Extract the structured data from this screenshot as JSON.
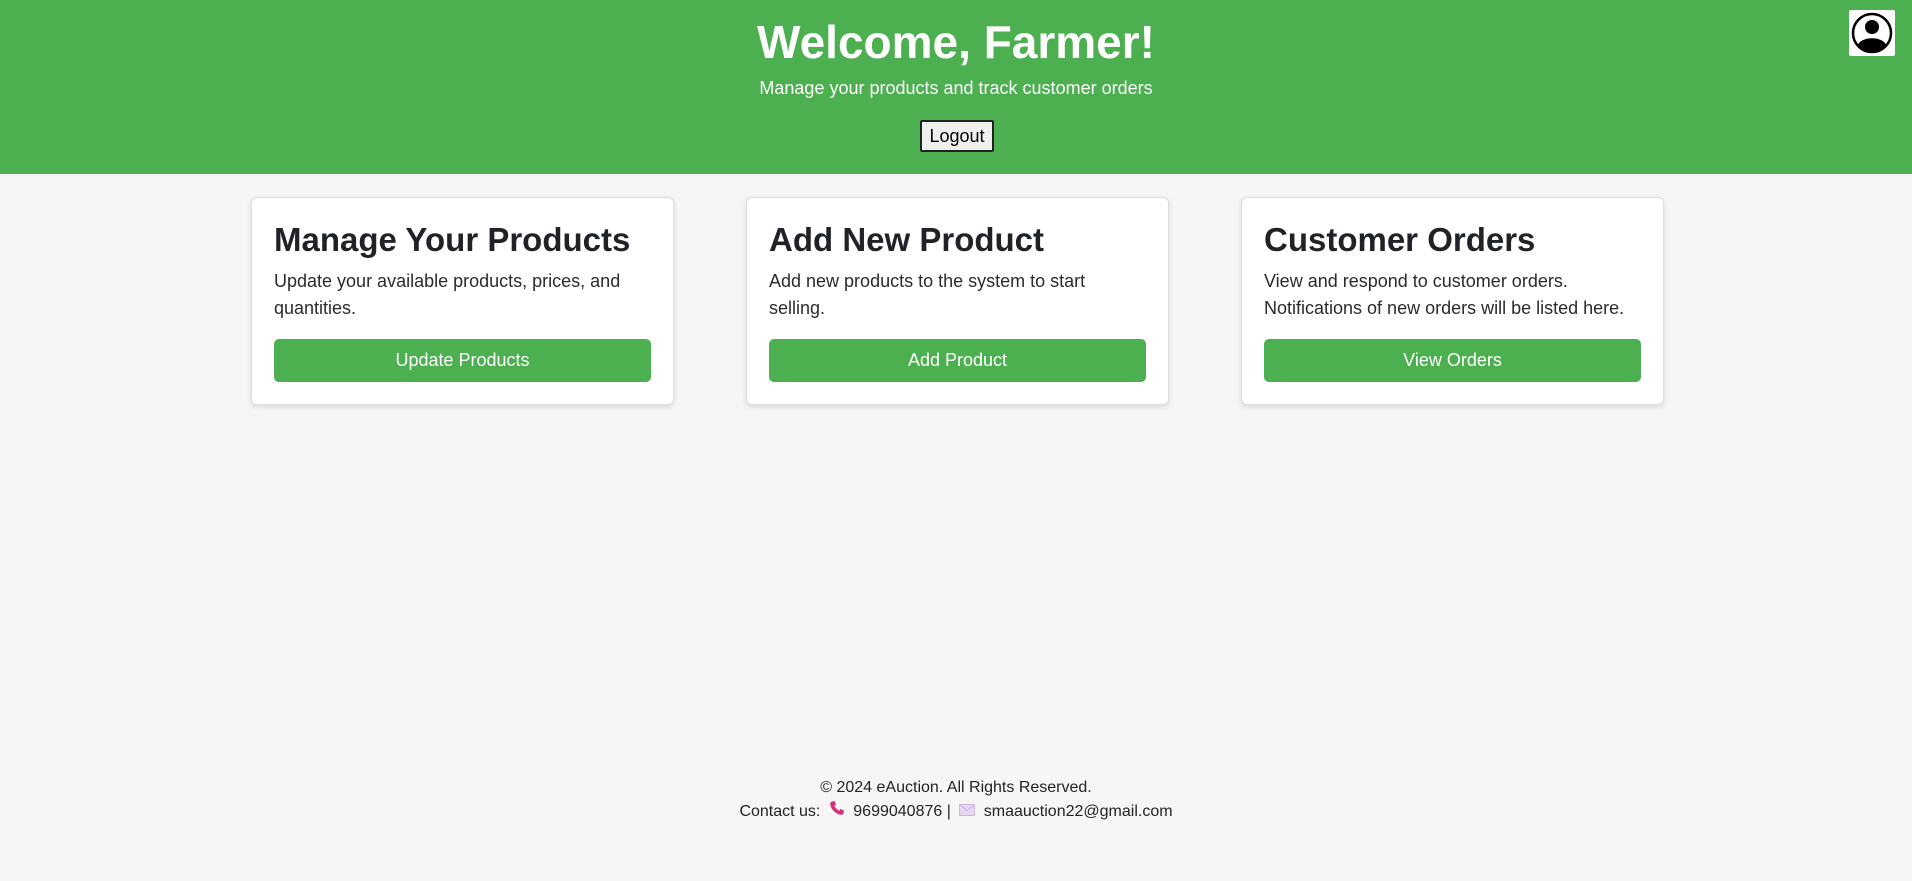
{
  "header": {
    "title": "Welcome, Farmer!",
    "subtitle": "Manage your products and track customer orders",
    "logout_label": "Logout",
    "profile_icon": "user-circle-icon"
  },
  "cards": [
    {
      "title": "Manage Your Products",
      "description": "Update your available products, prices, and quantities.",
      "button_label": "Update Products"
    },
    {
      "title": "Add New Product",
      "description": "Add new products to the system to start selling.",
      "button_label": "Add Product"
    },
    {
      "title": "Customer Orders",
      "description": "View and respond to customer orders. Notifications of new orders will be listed here.",
      "button_label": "View Orders"
    }
  ],
  "footer": {
    "copyright": "© 2024 eAuction. All Rights Reserved.",
    "contact_label": "Contact us:",
    "phone": "9699040876",
    "separator": "|",
    "email": "smaauction22@gmail.com"
  },
  "colors": {
    "brand": "#4caf50",
    "background": "#f6f6f6",
    "phone_icon": "#d6307a",
    "mail_icon": "#d9c4ec"
  }
}
